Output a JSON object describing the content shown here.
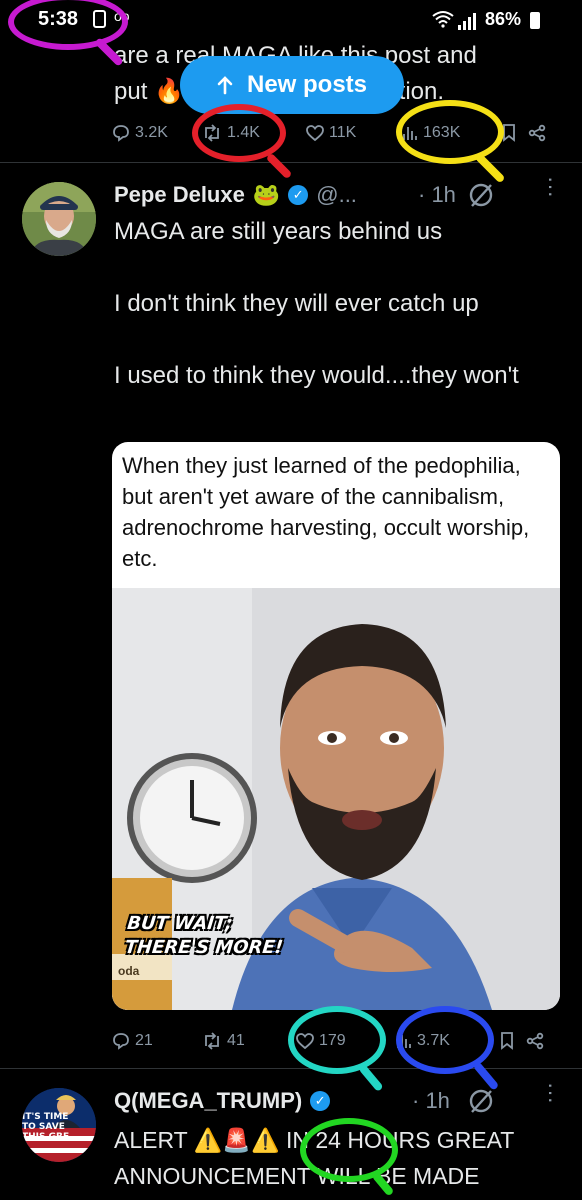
{
  "status_bar": {
    "time": "5:38",
    "battery": "86%"
  },
  "tweet1": {
    "text_line1": "are a real MAGA like this post and",
    "text_line2": "put 🔥 in the comment section.",
    "stats": {
      "replies": "3.2K",
      "reposts": "1.4K",
      "likes": "11K",
      "views": "163K"
    }
  },
  "new_posts_label": "New posts",
  "tweet2": {
    "author": "Pepe Deluxe",
    "author_emoji": "🐸",
    "handle": "@...",
    "time": "· 1h",
    "body": [
      "MAGA are still years behind us",
      "I don't think they will ever catch up",
      "I used to think they would....they won't"
    ],
    "media": {
      "caption": "When they just learned of the pedophilia, but aren't yet aware of the cannibalism, adrenochrome harvesting, occult worship, etc.",
      "overlay_line1": "BUT WAIT;",
      "overlay_line2": "THERE'S MORE!",
      "box_text": "oda"
    },
    "stats": {
      "replies": "21",
      "reposts": "41",
      "likes": "179",
      "views": "3.7K"
    }
  },
  "tweet3": {
    "author": "Q(MEGA_TRUMP)",
    "time": "· 1h",
    "avatar_text": [
      "IT'S TIME",
      "TO SAVE",
      "THIS GRE"
    ],
    "line1": "ALERT ⚠️🚨⚠️ IN 24 HOURS GREAT",
    "line2": "ANNOUNCEMENT WILL BE MADE"
  },
  "colors": {
    "accent": "#1d9bf0",
    "background": "#000000",
    "muted": "#8b98a5"
  }
}
